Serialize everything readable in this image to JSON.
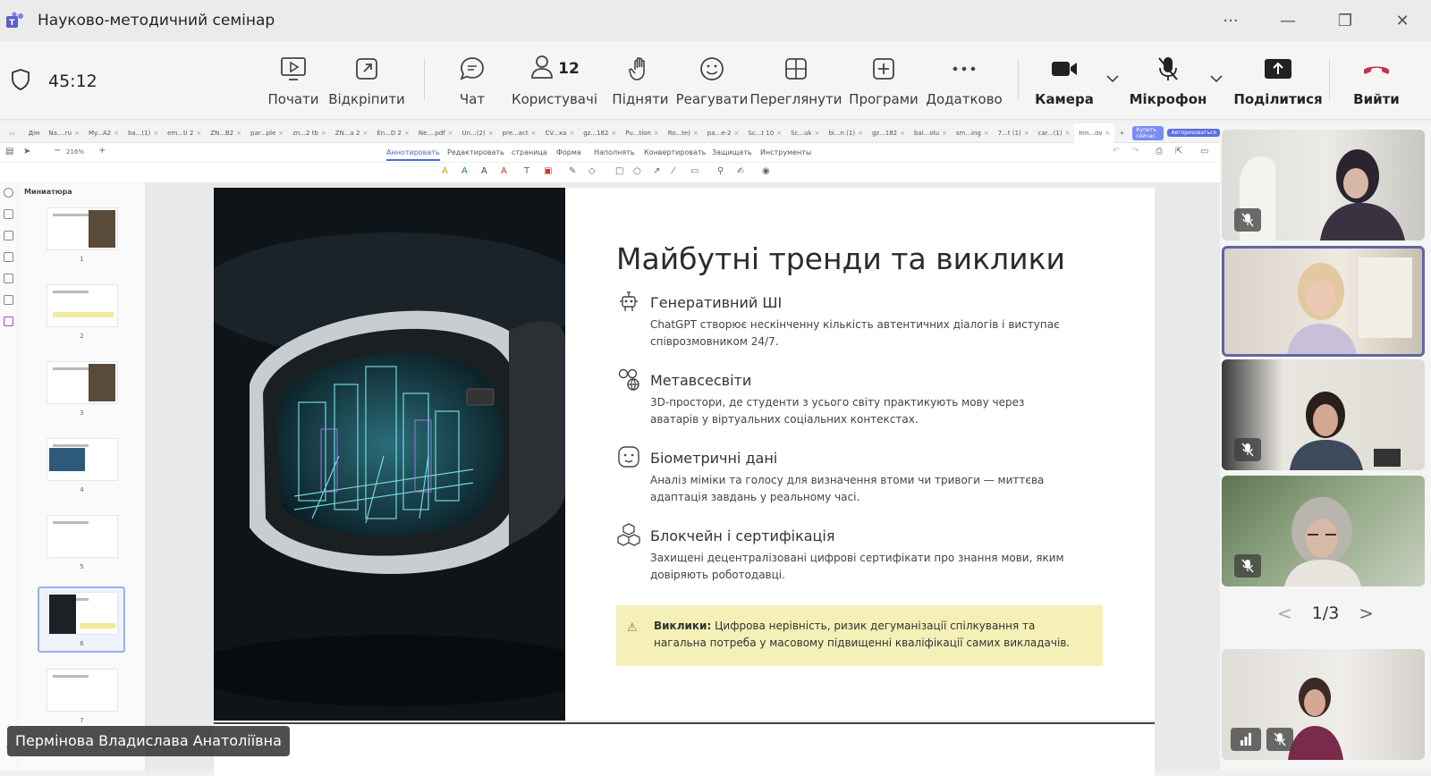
{
  "window": {
    "title": "Науково-методичний семінар",
    "controls": [
      "...",
      "minimize",
      "restore",
      "close"
    ]
  },
  "meeting": {
    "timer": "45:12",
    "toolbar": {
      "start": "Почати",
      "unpin": "Відкріпити",
      "chat": "Чат",
      "people": "Користувачі",
      "people_count": "12",
      "raise": "Підняти",
      "react": "Реагувати",
      "view": "Переглянути",
      "apps": "Програми",
      "more": "Додатково",
      "camera": "Камера",
      "mic": "Мікрофон",
      "share": "Поділитися",
      "leave": "Вийти"
    },
    "accent": "#6264a7",
    "leave_color": "#c4314b"
  },
  "viewer": {
    "tabs": [
      "Дім",
      "Na....ru",
      "My...A2",
      "ba...(1)",
      "em...ti 2",
      "ZN...B2",
      "par...ple",
      "zn...2 tb",
      "ZN...a 2",
      "En...D 2",
      "Ne....pdf",
      "Un...(2)",
      "pre...act",
      "CV...xa",
      "gz...182",
      "Pu...tion",
      "Ro...te)",
      "pa...e-2",
      "Sc...t 10",
      "Sc...uk",
      "bi...n (1)",
      "gz...182",
      "bai...olu",
      "sm...ing",
      "7...t (1)",
      "car...(1)",
      "Inn...ov"
    ],
    "buy_label": "Купить сейчас",
    "auth_label": "Авторизоваться",
    "zoom": "216%",
    "ribbon_tabs": [
      "Аннотировать",
      "Редактировать",
      "страница",
      "Форма",
      "Наполнять",
      "Конвертировать",
      "Защищать",
      "Инструменты"
    ],
    "thumbnails_title": "Миниатюра",
    "thumb_numbers": [
      "1",
      "2",
      "3",
      "4",
      "5",
      "6",
      "7"
    ]
  },
  "slide": {
    "title": "Майбутні тренди та виклики",
    "items": [
      {
        "icon": "robot-icon",
        "head": "Генеративний ШІ",
        "desc": "ChatGPT створює нескінченну кількість автентичних діалогів і виступає співрозмовником 24/7."
      },
      {
        "icon": "vr-globe-icon",
        "head": "Метавсесвіти",
        "desc": "3D-простори, де студенти з усього світу практикують мову через аватарів у віртуальних соціальних контекстах."
      },
      {
        "icon": "face-scan-icon",
        "head": "Біометричні дані",
        "desc": "Аналіз міміки та голосу для визначення втоми чи тривоги — миттєва адаптація завдань у реальному часі."
      },
      {
        "icon": "blocks-icon",
        "head": "Блокчейн і сертифікація",
        "desc": "Захищені децентралізовані цифрові сертифікати про знання мови, яким довіряють роботодавці."
      }
    ],
    "challenge_label": "Виклики:",
    "challenge_text": "Цифрова нерівність, ризик дегуманізації спілкування та нагальна потреба у масовому підвищенні кваліфікації самих викладачів."
  },
  "participants": {
    "pager": "1/3",
    "speaker_name": "Пермінова Владислава Анатоліївна"
  }
}
